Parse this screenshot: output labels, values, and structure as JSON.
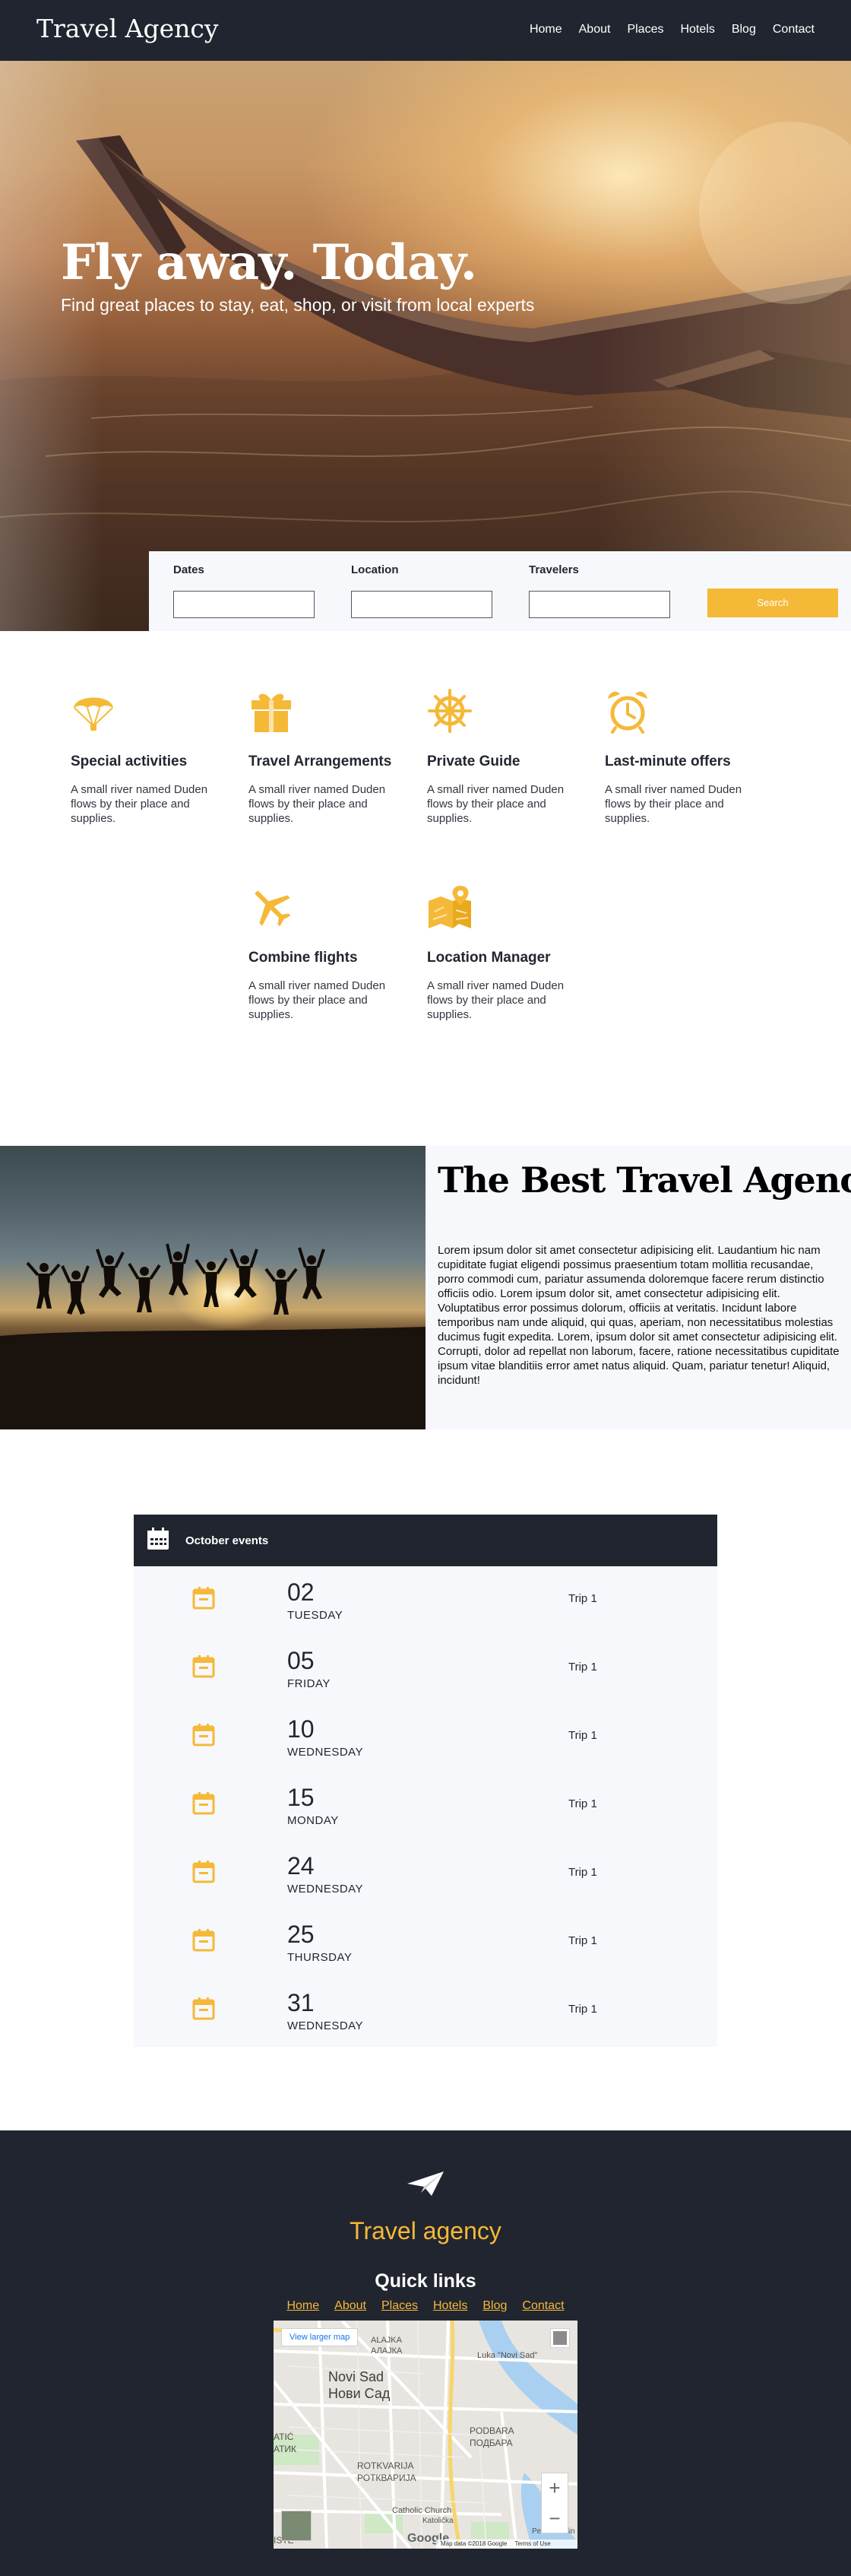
{
  "nav": {
    "brand": "Travel Agency",
    "links": [
      "Home",
      "About",
      "Places",
      "Hotels",
      "Blog",
      "Contact"
    ]
  },
  "hero": {
    "title": "Fly away. Today.",
    "subtitle": "Find great places to stay, eat, shop, or visit from local experts"
  },
  "booking": {
    "dates_label": "Dates",
    "location_label": "Location",
    "travelers_label": "Travelers",
    "dates_value": "",
    "location_value": "",
    "travelers_value": "",
    "search_label": "Search"
  },
  "services": [
    {
      "icon": "parachute-icon",
      "title": "Special activities",
      "text": "A small river named Duden flows by their place and supplies."
    },
    {
      "icon": "gift-icon",
      "title": "Travel Arrangements",
      "text": "A small river named Duden flows by their place and supplies."
    },
    {
      "icon": "ship-wheel-icon",
      "title": "Private Guide",
      "text": "A small river named Duden flows by their place and supplies."
    },
    {
      "icon": "alarm-clock-icon",
      "title": "Last-minute offers",
      "text": "A small river named Duden flows by their place and supplies."
    },
    {
      "icon": "airplane-icon",
      "title": "Combine flights",
      "text": "A small river named Duden flows by their place and supplies."
    },
    {
      "icon": "map-location-icon",
      "title": "Location Manager",
      "text": "A small river named Duden flows by their place and supplies."
    }
  ],
  "about": {
    "title": "The Best Travel Agency",
    "text": "Lorem ipsum dolor sit amet consectetur adipisicing elit. Laudantium hic nam cupiditate fugiat eligendi possimus praesentium totam mollitia recusandae, porro commodi cum, pariatur assumenda doloremque facere rerum distinctio officiis odio. Lorem ipsum dolor sit, amet consectetur adipisicing elit. Voluptatibus error possimus dolorum, officiis at veritatis. Incidunt labore temporibus nam unde aliquid, qui quas, aperiam, non necessitatibus molestias ducimus fugit expedita. Lorem, ipsum dolor sit amet consectetur adipisicing elit. Corrupti, dolor ad repellat non laborum, facere, ratione necessitatibus cupiditate ipsum vitae blanditiis error amet natus aliquid. Quam, pariatur tenetur! Aliquid, incidunt!"
  },
  "events": {
    "title": "October events",
    "items": [
      {
        "day": "02",
        "weekday": "TUESDAY",
        "trip": "Trip 1"
      },
      {
        "day": "05",
        "weekday": "FRIDAY",
        "trip": "Trip 1"
      },
      {
        "day": "10",
        "weekday": "WEDNESDAY",
        "trip": "Trip 1"
      },
      {
        "day": "15",
        "weekday": "MONDAY",
        "trip": "Trip 1"
      },
      {
        "day": "24",
        "weekday": "WEDNESDAY",
        "trip": "Trip 1"
      },
      {
        "day": "25",
        "weekday": "THURSDAY",
        "trip": "Trip 1"
      },
      {
        "day": "31",
        "weekday": "WEDNESDAY",
        "trip": "Trip 1"
      }
    ]
  },
  "footer": {
    "brand": "Travel agency",
    "quick_links_title": "Quick links",
    "links": [
      "Home",
      "About",
      "Places",
      "Hotels",
      "Blog",
      "Contact"
    ],
    "map": {
      "view_larger": "View larger map",
      "labels": [
        "ALAJKA",
        "АЛАЈКА",
        "Novi Sad",
        "Нови Сад",
        "Luka \"Novi Sad\"",
        "PODBARA",
        "ПОДБАРА",
        "ROTKVARIJA",
        "РОТКВАРИЈА",
        "Catholic Church",
        "Katolička",
        "ATIĆ",
        "АТИК",
        "ISTE",
        "Petrovaradin"
      ],
      "attribution": "Map data ©2018 Google",
      "terms": "Terms of Use",
      "google": "Google"
    }
  },
  "colors": {
    "accent": "#f5b938",
    "dark": "#21252f",
    "light_panel": "#f7f8fc"
  }
}
